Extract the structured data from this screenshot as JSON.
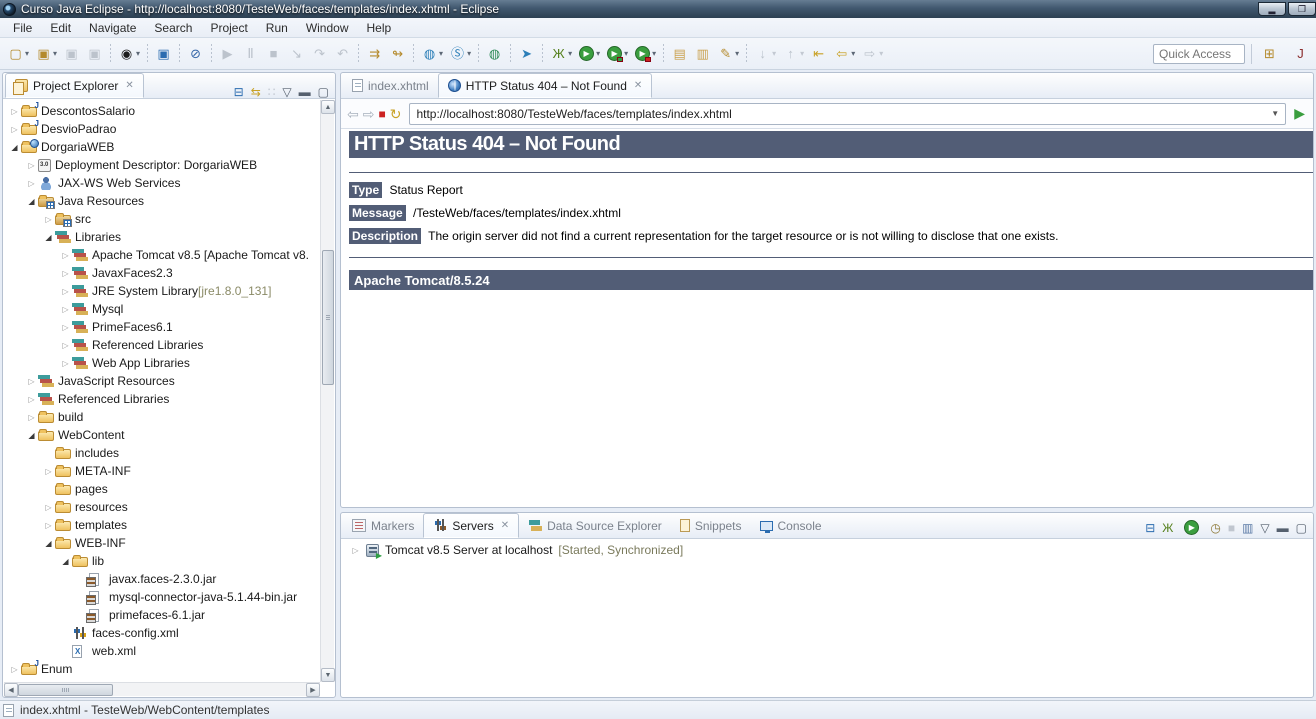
{
  "window": {
    "title": "Curso Java Eclipse - http://localhost:8080/TesteWeb/faces/templates/index.xhtml - Eclipse",
    "minimize_glyph": "▂",
    "maximize_glyph": "❐"
  },
  "menu": {
    "items": [
      "File",
      "Edit",
      "Navigate",
      "Search",
      "Project",
      "Run",
      "Window",
      "Help"
    ]
  },
  "toolbar": {
    "quick_access": "Quick Access",
    "items": [
      {
        "name": "new-wizard",
        "glyph": "▢",
        "color": "#b48a2c",
        "dd": true
      },
      {
        "name": "new-java-ee-item",
        "glyph": "▣",
        "color": "#b48a2c",
        "dd": true
      },
      {
        "name": "save",
        "glyph": "▣",
        "disabled": true
      },
      {
        "name": "save-all",
        "glyph": "▣",
        "disabled": true
      },
      {
        "sep": true
      },
      {
        "name": "user-account",
        "glyph": "◉",
        "color": "#1c1c1c",
        "dd": true
      },
      {
        "sep": true
      },
      {
        "name": "remote-systems",
        "glyph": "▣",
        "color": "#2b6cb0"
      },
      {
        "sep": true
      },
      {
        "name": "skip-all-breakpoints",
        "glyph": "⊘",
        "color": "#3566a8"
      },
      {
        "sep": true
      },
      {
        "name": "resume",
        "glyph": "▶",
        "disabled": true
      },
      {
        "name": "pause",
        "glyph": "Ⅱ",
        "disabled": true
      },
      {
        "name": "terminate",
        "glyph": "■",
        "disabled": true
      },
      {
        "name": "step-into",
        "glyph": "↘",
        "disabled": true
      },
      {
        "name": "step-over",
        "glyph": "↷",
        "disabled": true
      },
      {
        "name": "step-return",
        "glyph": "↶",
        "disabled": true
      },
      {
        "sep": true
      },
      {
        "name": "run-last-launched",
        "glyph": "⇉",
        "color": "#b48a2c"
      },
      {
        "name": "use-step-filters",
        "glyph": "↬",
        "color": "#b48a2c"
      },
      {
        "sep": true
      },
      {
        "name": "new-web-service",
        "glyph": "◍",
        "color": "#2c7fb8",
        "dd": true
      },
      {
        "name": "web-service-client",
        "glyph": "Ⓢ",
        "color": "#2c7fb8",
        "dd": true
      },
      {
        "sep": true
      },
      {
        "name": "internal-web-browser",
        "glyph": "◍",
        "color": "#2e8b57"
      },
      {
        "sep": true
      },
      {
        "name": "launch-web-service-explorer",
        "glyph": "➤",
        "color": "#2c7fb8"
      },
      {
        "sep": true
      },
      {
        "name": "debug",
        "glyph": "Ж",
        "color": "#55801c",
        "dd": true
      },
      {
        "name": "run",
        "glyph": "▶",
        "circle": "#3a9e3f",
        "dd": true
      },
      {
        "name": "coverage",
        "glyph": "▶",
        "circle": "#3a9e3f",
        "badge": "#2f9e44",
        "dd": true
      },
      {
        "name": "profile",
        "glyph": "▶",
        "circle": "#3a9e3f",
        "badge": "#cc2222",
        "dd": true
      },
      {
        "sep": true
      },
      {
        "name": "open-task",
        "glyph": "▤",
        "color": "#caa14f"
      },
      {
        "name": "open-resource",
        "glyph": "▥",
        "color": "#caa14f"
      },
      {
        "name": "pin-editor",
        "glyph": "✎",
        "color": "#b48a2c",
        "dd": true
      },
      {
        "sep": true
      },
      {
        "name": "next-annotation",
        "glyph": "↓",
        "disabled": true,
        "dd": true
      },
      {
        "name": "previous-annotation",
        "glyph": "↑",
        "disabled": true,
        "dd": true
      },
      {
        "name": "last-edit-location",
        "glyph": "⇤",
        "color": "#c9a227"
      },
      {
        "name": "back",
        "glyph": "⇦",
        "color": "#c9a227",
        "dd": true
      },
      {
        "name": "forward",
        "glyph": "⇨",
        "disabled": true,
        "dd": true
      }
    ],
    "right_icons": [
      {
        "name": "open-perspective",
        "glyph": "⊞",
        "color": "#b48a2c"
      },
      {
        "name": "java-ee-perspective",
        "glyph": "Ј",
        "color": "#8b2e2e"
      }
    ]
  },
  "project_explorer": {
    "title": "Project Explorer",
    "header_icons": [
      {
        "name": "collapse-all",
        "glyph": "⊟",
        "color": "#2b6cb0"
      },
      {
        "name": "link-with-editor",
        "glyph": "⇆",
        "color": "#c9a227"
      },
      {
        "name": "focus-on-active-task",
        "glyph": "∷",
        "disabled": true
      },
      {
        "name": "view-menu",
        "glyph": "▽",
        "color": "#55606e"
      },
      {
        "name": "minimize",
        "glyph": "▬",
        "color": "#55606e"
      },
      {
        "name": "maximize",
        "glyph": "▢",
        "color": "#55606e"
      }
    ],
    "tree": [
      {
        "label": "DescontosSalario",
        "level": 0,
        "state": "c",
        "icon": "java-project"
      },
      {
        "label": "DesvioPadrao",
        "level": 0,
        "state": "c",
        "icon": "java-project"
      },
      {
        "label": "DorgariaWEB",
        "level": 0,
        "state": "e",
        "icon": "web-project"
      },
      {
        "label": "Deployment Descriptor: DorgariaWEB",
        "level": 1,
        "state": "c",
        "icon": "deployment-descriptor"
      },
      {
        "label": "JAX-WS Web Services",
        "level": 1,
        "state": "c",
        "icon": "jaxws"
      },
      {
        "label": "Java Resources",
        "level": 1,
        "state": "e",
        "icon": "source-folder"
      },
      {
        "label": "src",
        "level": 2,
        "state": "c",
        "icon": "package-folder"
      },
      {
        "label": "Libraries",
        "level": 2,
        "state": "e",
        "icon": "library"
      },
      {
        "label": "Apache Tomcat v8.5 [Apache Tomcat v8.",
        "level": 3,
        "state": "c",
        "icon": "library"
      },
      {
        "label": "JavaxFaces2.3",
        "level": 3,
        "state": "c",
        "icon": "library"
      },
      {
        "label": "JRE System Library",
        "suffix": " [jre1.8.0_131]",
        "level": 3,
        "state": "c",
        "icon": "library"
      },
      {
        "label": "Mysql",
        "level": 3,
        "state": "c",
        "icon": "library"
      },
      {
        "label": "PrimeFaces6.1",
        "level": 3,
        "state": "c",
        "icon": "library"
      },
      {
        "label": "Referenced Libraries",
        "level": 3,
        "state": "c",
        "icon": "library"
      },
      {
        "label": "Web App Libraries",
        "level": 3,
        "state": "c",
        "icon": "library"
      },
      {
        "label": "JavaScript Resources",
        "level": 1,
        "state": "c",
        "icon": "library"
      },
      {
        "label": "Referenced Libraries",
        "level": 1,
        "state": "c",
        "icon": "library"
      },
      {
        "label": "build",
        "level": 1,
        "state": "c",
        "icon": "folder"
      },
      {
        "label": "WebContent",
        "level": 1,
        "state": "e",
        "icon": "folder"
      },
      {
        "label": "includes",
        "level": 2,
        "state": "l",
        "icon": "folder"
      },
      {
        "label": "META-INF",
        "level": 2,
        "state": "c",
        "icon": "folder"
      },
      {
        "label": "pages",
        "level": 2,
        "state": "l",
        "icon": "folder"
      },
      {
        "label": "resources",
        "level": 2,
        "state": "c",
        "icon": "folder"
      },
      {
        "label": "templates",
        "level": 2,
        "state": "c",
        "icon": "folder"
      },
      {
        "label": "WEB-INF",
        "level": 2,
        "state": "e",
        "icon": "folder"
      },
      {
        "label": "lib",
        "level": 3,
        "state": "e",
        "icon": "folder"
      },
      {
        "label": "javax.faces-2.3.0.jar",
        "level": 4,
        "state": "l",
        "icon": "jar"
      },
      {
        "label": "mysql-connector-java-5.1.44-bin.jar",
        "level": 4,
        "state": "l",
        "icon": "jar"
      },
      {
        "label": "primefaces-6.1.jar",
        "level": 4,
        "state": "l",
        "icon": "jar"
      },
      {
        "label": "faces-config.xml",
        "level": 3,
        "state": "l",
        "icon": "faces-config"
      },
      {
        "label": "web.xml",
        "level": 3,
        "state": "l",
        "icon": "xml-file"
      },
      {
        "label": "Enum",
        "level": 0,
        "state": "c",
        "icon": "java-project"
      }
    ]
  },
  "editor": {
    "tabs": [
      {
        "label": "index.xhtml",
        "icon": "file"
      },
      {
        "label": "HTTP Status 404 – Not Found",
        "icon": "globe",
        "active": true,
        "closable": true
      }
    ],
    "browser": {
      "url": "http://localhost:8080/TesteWeb/faces/templates/index.xhtml",
      "back_glyph": "⇦",
      "forward_glyph": "⇨",
      "stop_glyph": "■",
      "refresh_glyph": "↻",
      "go_glyph": "▶"
    },
    "page404": {
      "accent": "#525D76",
      "title": "HTTP Status 404 – Not Found",
      "fields": [
        {
          "label": "Type",
          "value": "Status Report"
        },
        {
          "label": "Message",
          "value": "/TesteWeb/faces/templates/index.xhtml"
        },
        {
          "label": "Description",
          "value": "The origin server did not find a current representation for the target resource or is not willing to disclose that one exists."
        }
      ],
      "footer": "Apache Tomcat/8.5.24"
    }
  },
  "bottom_panel": {
    "tabs": [
      {
        "label": "Markers",
        "icon": "markers"
      },
      {
        "label": "Servers",
        "icon": "servers",
        "active": true,
        "closable": true
      },
      {
        "label": "Data Source Explorer",
        "icon": "datasource"
      },
      {
        "label": "Snippets",
        "icon": "snippets"
      },
      {
        "label": "Console",
        "icon": "console"
      }
    ],
    "right_icons": [
      {
        "name": "collapse-all",
        "glyph": "⊟",
        "color": "#2b6cb0"
      },
      {
        "name": "debug-on-server",
        "glyph": "Ж",
        "color": "#55801c"
      },
      {
        "name": "start-server",
        "glyph": "▶",
        "circle": "#3a9e3f"
      },
      {
        "name": "profile-server",
        "glyph": "◷",
        "color": "#8a7430"
      },
      {
        "name": "stop-server",
        "glyph": "■",
        "disabled": true
      },
      {
        "name": "publish",
        "glyph": "▥",
        "color": "#5b7aa6"
      },
      {
        "name": "view-menu",
        "glyph": "▽",
        "color": "#55606e"
      },
      {
        "name": "minimize-panel",
        "glyph": "▬",
        "color": "#55606e"
      },
      {
        "name": "maximize-panel",
        "glyph": "▢",
        "color": "#55606e"
      }
    ],
    "server": {
      "name": "Tomcat v8.5 Server at localhost",
      "status": "[Started, Synchronized]"
    }
  },
  "status_bar": {
    "text": "index.xhtml - TesteWeb/WebContent/templates"
  }
}
